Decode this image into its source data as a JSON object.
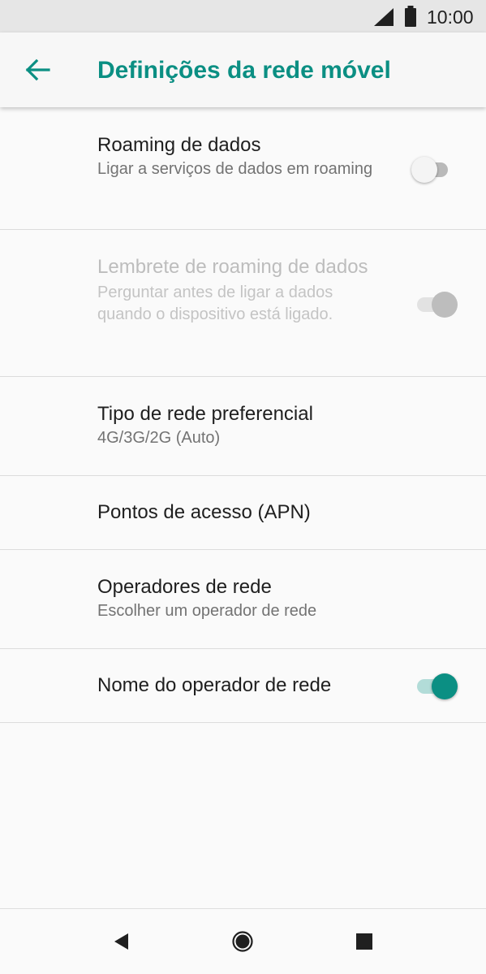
{
  "status_bar": {
    "time": "10:00",
    "icons": [
      "cellular-signal-icon",
      "battery-icon"
    ]
  },
  "app_bar": {
    "back_icon": "arrow-left-icon",
    "title": "Definições da rede móvel"
  },
  "settings": {
    "data_roaming": {
      "title": "Roaming de dados",
      "summary": "Ligar a serviços de dados em roaming",
      "enabled": true,
      "checked": false
    },
    "roaming_reminder": {
      "title": "Lembrete de roaming de dados",
      "summary": "Perguntar antes de ligar a dados quando o dispositivo está ligado.",
      "enabled": false,
      "checked": true
    },
    "preferred_network": {
      "title": "Tipo de rede preferencial",
      "summary": "4G/3G/2G (Auto)"
    },
    "access_points": {
      "title": "Pontos de acesso (APN)"
    },
    "network_operators": {
      "title": "Operadores de rede",
      "summary": "Escolher um operador de rede"
    },
    "operator_name": {
      "title": "Nome do operador de rede",
      "enabled": true,
      "checked": true
    }
  },
  "nav_bar": {
    "icons": [
      "back-triangle-icon",
      "home-circle-icon",
      "recents-square-icon"
    ]
  },
  "colors": {
    "accent": "#0b8f83",
    "accent_track": "#b2dcd8",
    "status_bar_bg": "#e6e6e6",
    "app_bar_bg": "#f7f7f7",
    "background": "#fafafa",
    "divider": "#dcdcdc"
  }
}
